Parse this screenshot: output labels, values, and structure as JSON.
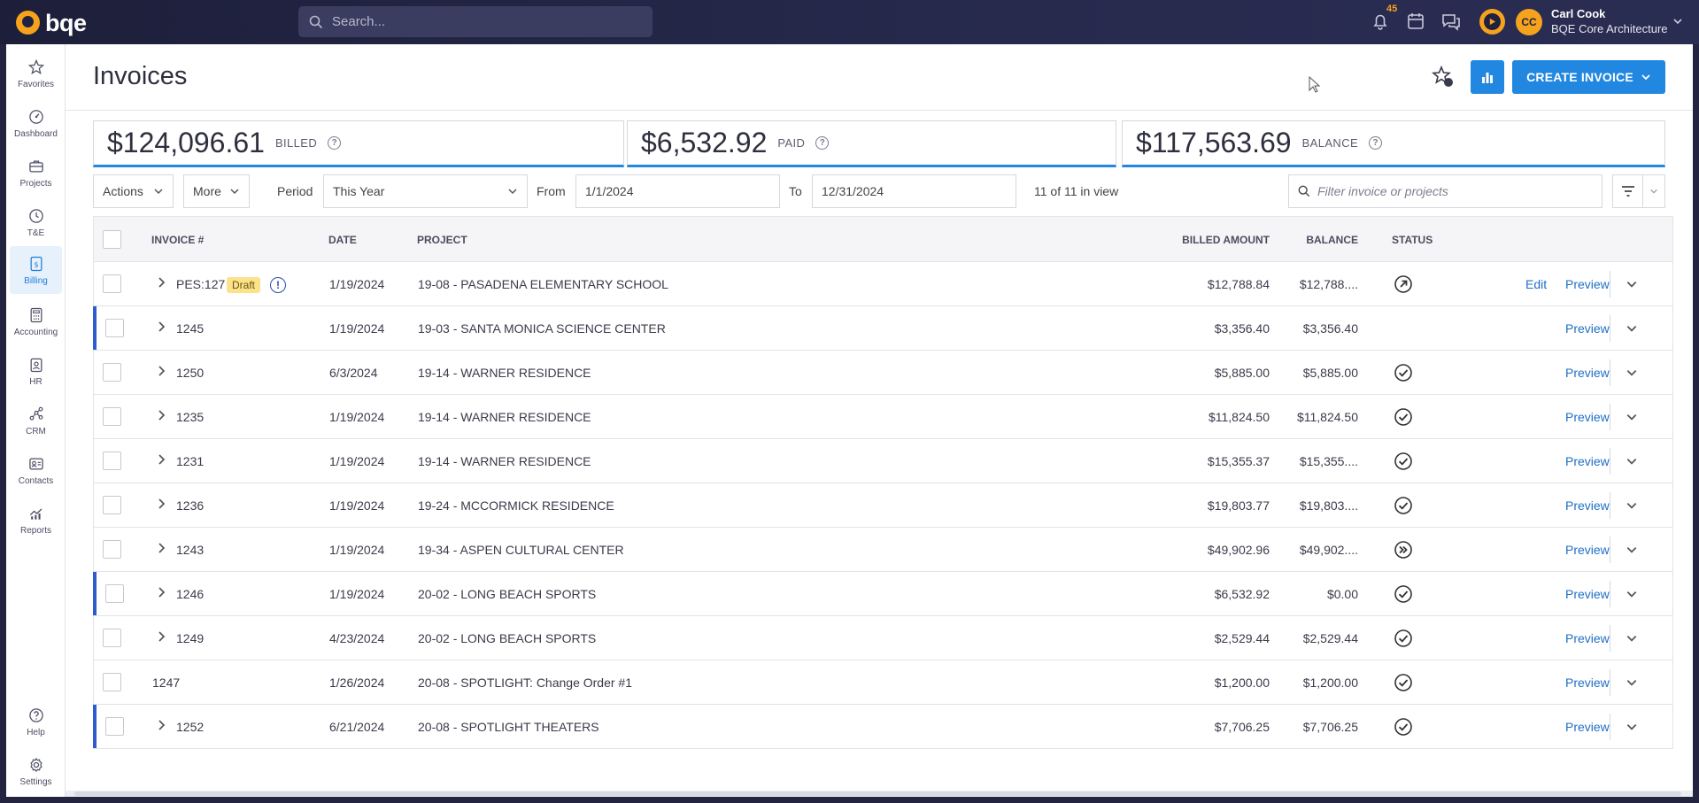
{
  "app": {
    "brand": "bqe"
  },
  "search": {
    "placeholder": "Search..."
  },
  "notifications": {
    "count": "45"
  },
  "user": {
    "initials": "CC",
    "name": "Carl Cook",
    "org": "BQE Core Architecture"
  },
  "sidebar": {
    "items": [
      {
        "label": "Favorites",
        "icon": "star-icon"
      },
      {
        "label": "Dashboard",
        "icon": "gauge-icon"
      },
      {
        "label": "Projects",
        "icon": "briefcase-icon"
      },
      {
        "label": "T&E",
        "icon": "clock-icon"
      },
      {
        "label": "Billing",
        "icon": "invoice-icon",
        "active": true
      },
      {
        "label": "Accounting",
        "icon": "calculator-icon"
      },
      {
        "label": "HR",
        "icon": "badge-icon"
      },
      {
        "label": "CRM",
        "icon": "network-icon"
      },
      {
        "label": "Contacts",
        "icon": "contact-card-icon"
      },
      {
        "label": "Reports",
        "icon": "chart-icon"
      },
      {
        "label": "Help",
        "icon": "help-icon"
      },
      {
        "label": "Settings",
        "icon": "gear-icon"
      }
    ]
  },
  "page": {
    "title": "Invoices",
    "create_label": "CREATE INVOICE"
  },
  "summary": {
    "billed": {
      "amount": "$124,096.61",
      "label": "BILLED"
    },
    "paid": {
      "amount": "$6,532.92",
      "label": "PAID"
    },
    "balance": {
      "amount": "$117,563.69",
      "label": "BALANCE"
    },
    "help": "?"
  },
  "filters": {
    "actions_label": "Actions",
    "more_label": "More",
    "period_label": "Period",
    "period_value": "This Year",
    "from_label": "From",
    "from_value": "1/1/2024",
    "to_label": "To",
    "to_value": "12/31/2024",
    "in_view": "11 of 11 in view",
    "filter_placeholder": "Filter invoice or projects"
  },
  "table": {
    "columns": {
      "invoice": "INVOICE #",
      "date": "DATE",
      "project": "PROJECT",
      "billed": "BILLED AMOUNT",
      "balance": "BALANCE",
      "status": "STATUS"
    },
    "edit_label": "Edit",
    "preview_label": "Preview",
    "draft_label": "Draft",
    "warn_glyph": "!",
    "rows": [
      {
        "invoice": "PES:127",
        "date": "1/19/2024",
        "project": "19-08 - PASADENA ELEMENTARY SCHOOL",
        "billed": "$12,788.84",
        "balance": "$12,788....",
        "status": "sent-icon",
        "draft": true,
        "edit": true,
        "expand": true,
        "marked": false
      },
      {
        "invoice": "1245",
        "date": "1/19/2024",
        "project": "19-03 - SANTA MONICA SCIENCE CENTER",
        "billed": "$3,356.40",
        "balance": "$3,356.40",
        "status": "",
        "expand": true,
        "marked": true
      },
      {
        "invoice": "1250",
        "date": "6/3/2024",
        "project": "19-14 - WARNER RESIDENCE",
        "billed": "$5,885.00",
        "balance": "$5,885.00",
        "status": "check-circle-icon",
        "expand": true,
        "marked": false
      },
      {
        "invoice": "1235",
        "date": "1/19/2024",
        "project": "19-14 - WARNER RESIDENCE",
        "billed": "$11,824.50",
        "balance": "$11,824.50",
        "status": "check-circle-icon",
        "expand": true,
        "marked": false
      },
      {
        "invoice": "1231",
        "date": "1/19/2024",
        "project": "19-14 - WARNER RESIDENCE",
        "billed": "$15,355.37",
        "balance": "$15,355....",
        "status": "check-circle-icon",
        "expand": true,
        "marked": false
      },
      {
        "invoice": "1236",
        "date": "1/19/2024",
        "project": "19-24 - MCCORMICK RESIDENCE",
        "billed": "$19,803.77",
        "balance": "$19,803....",
        "status": "check-circle-icon",
        "expand": true,
        "marked": false
      },
      {
        "invoice": "1243",
        "date": "1/19/2024",
        "project": "19-34 - ASPEN CULTURAL CENTER",
        "billed": "$49,902.96",
        "balance": "$49,902....",
        "status": "fast-forward-circle-icon",
        "expand": true,
        "marked": false
      },
      {
        "invoice": "1246",
        "date": "1/19/2024",
        "project": "20-02 - LONG BEACH SPORTS",
        "billed": "$6,532.92",
        "balance": "$0.00",
        "status": "check-circle-icon",
        "expand": true,
        "marked": true
      },
      {
        "invoice": "1249",
        "date": "4/23/2024",
        "project": "20-02 - LONG BEACH SPORTS",
        "billed": "$2,529.44",
        "balance": "$2,529.44",
        "status": "check-circle-icon",
        "expand": true,
        "marked": false
      },
      {
        "invoice": "1247",
        "date": "1/26/2024",
        "project": "20-08 - SPOTLIGHT: Change Order #1",
        "billed": "$1,200.00",
        "balance": "$1,200.00",
        "status": "check-circle-icon",
        "expand": false,
        "marked": false
      },
      {
        "invoice": "1252",
        "date": "6/21/2024",
        "project": "20-08 - SPOTLIGHT THEATERS",
        "billed": "$7,706.25",
        "balance": "$7,706.25",
        "status": "check-circle-icon",
        "expand": true,
        "marked": true
      }
    ]
  },
  "colors": {
    "accent": "#2187e0",
    "brand": "#f5a21d",
    "topbar": "#23243f",
    "draft": "#fbe28b",
    "marker": "#2f5bd0"
  }
}
